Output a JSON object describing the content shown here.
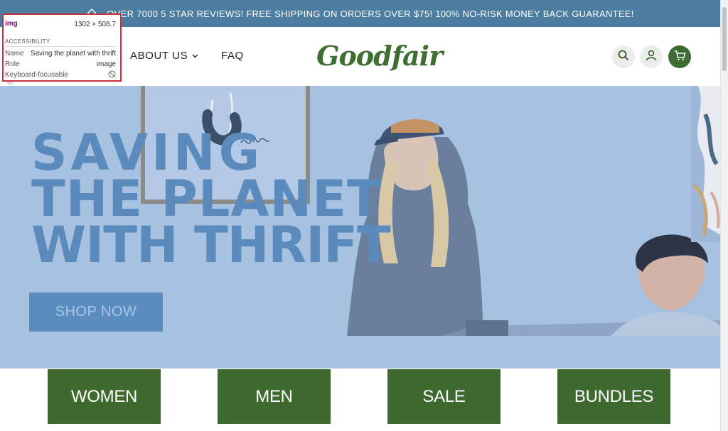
{
  "announcement": {
    "text": "OVER 7000 5 STAR REVIEWS! FREE SHIPPING ON ORDERS OVER $75! 100% NO-RISK MONEY BACK GUARANTEE!"
  },
  "header": {
    "nav": [
      {
        "label": "ABOUT US"
      },
      {
        "label": "FAQ"
      }
    ],
    "logo_text": "Goodfair",
    "icons": [
      "search-icon",
      "account-icon",
      "cart-icon"
    ]
  },
  "hero": {
    "title_lines": [
      "SAVING",
      "THE PLANET",
      "WITH THRIFT"
    ],
    "cta_label": "SHOP NOW",
    "image_alt": "Saving the planet with thrift"
  },
  "devtools_tooltip": {
    "tag": "img",
    "dimensions": "1302 × 508.7",
    "section": "ACCESSIBILITY",
    "name_label": "Name",
    "name_value": "Saving the planet with thrift",
    "role_label": "Role",
    "role_value": "image",
    "focus_label": "Keyboard-focusable"
  },
  "categories": [
    {
      "label": "WOMEN"
    },
    {
      "label": "MEN"
    },
    {
      "label": "SALE"
    },
    {
      "label": "BUNDLES"
    }
  ],
  "colors": {
    "announcement_bg": "#4b7da0",
    "brand_green": "#3e6a2f",
    "hero_bg": "#a7c1e1",
    "hero_text": "#5b8bbc",
    "devtools_highlight": "#c8303a"
  }
}
